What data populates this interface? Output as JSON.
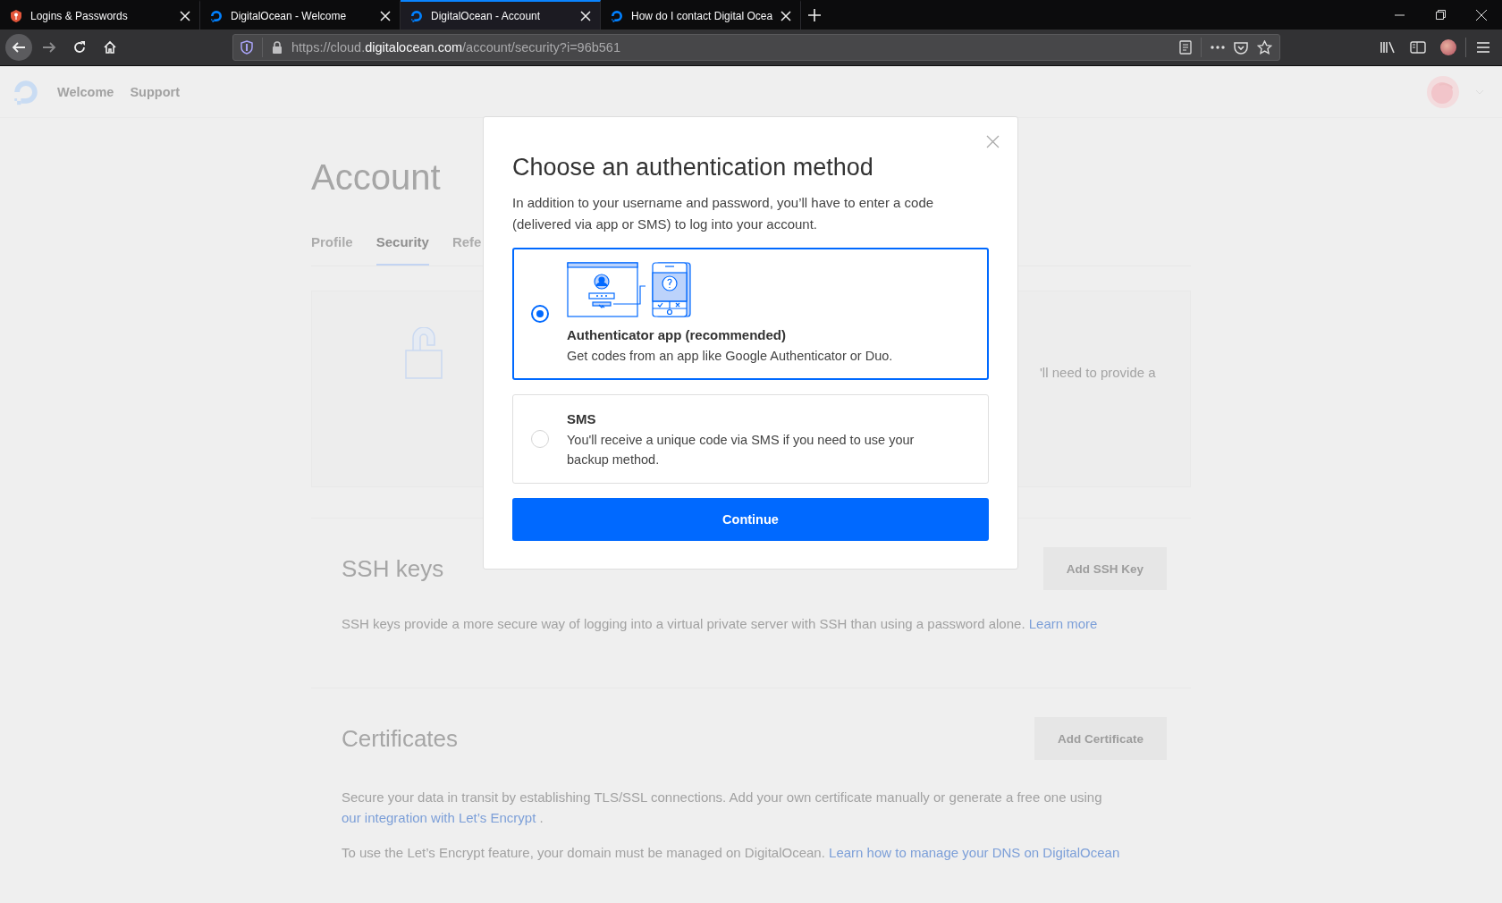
{
  "browser": {
    "tabs": [
      {
        "title": "Logins & Passwords",
        "selected": false
      },
      {
        "title": "DigitalOcean - Welcome",
        "selected": false
      },
      {
        "title": "DigitalOcean - Account",
        "selected": true
      },
      {
        "title": "How do I contact Digital Ocea",
        "selected": false
      }
    ],
    "url": {
      "prefix": "https://cloud.",
      "domain": "digitalocean.com",
      "path": "/account/security?i=96b561"
    }
  },
  "page": {
    "nav": [
      "Welcome",
      "Support"
    ],
    "title": "Account",
    "tabs": [
      {
        "label": "Profile",
        "selected": false
      },
      {
        "label": "Security",
        "selected": true
      },
      {
        "label": "Refe",
        "selected": false
      }
    ],
    "security_text": "'ll need to provide a",
    "sections": [
      {
        "title": "SSH keys",
        "button": "Add SSH Key",
        "paragraphs": [
          {
            "text": "SSH keys provide a more secure way of logging into a virtual private server with SSH than using a password alone.",
            "link": "Learn more"
          }
        ]
      },
      {
        "title": "Certificates",
        "button": "Add Certificate",
        "paragraphs": [
          {
            "text": "Secure your data in transit by establishing TLS/SSL connections. Add your own certificate manually or generate a free one using",
            "link": "our integration with Let’s Encrypt",
            "after": " ."
          },
          {
            "text": "To use the Let’s Encrypt feature, your domain must be managed on DigitalOcean.",
            "link": "Learn how to manage your DNS on DigitalOcean"
          }
        ]
      }
    ]
  },
  "modal": {
    "title": "Choose an authentication method",
    "description": "In addition to your username and password, you’ll have to enter a code (delivered via app or SMS) to log into your account.",
    "options": [
      {
        "kind": "illustrated",
        "title": "Authenticator app (recommended)",
        "description": "Get codes from an app like Google Authenticator or Duo.",
        "selected": true
      },
      {
        "kind": "plain",
        "title": "SMS",
        "description": "You'll receive a unique code via SMS if you need to use your backup method.",
        "selected": false
      }
    ],
    "button": "Continue"
  }
}
